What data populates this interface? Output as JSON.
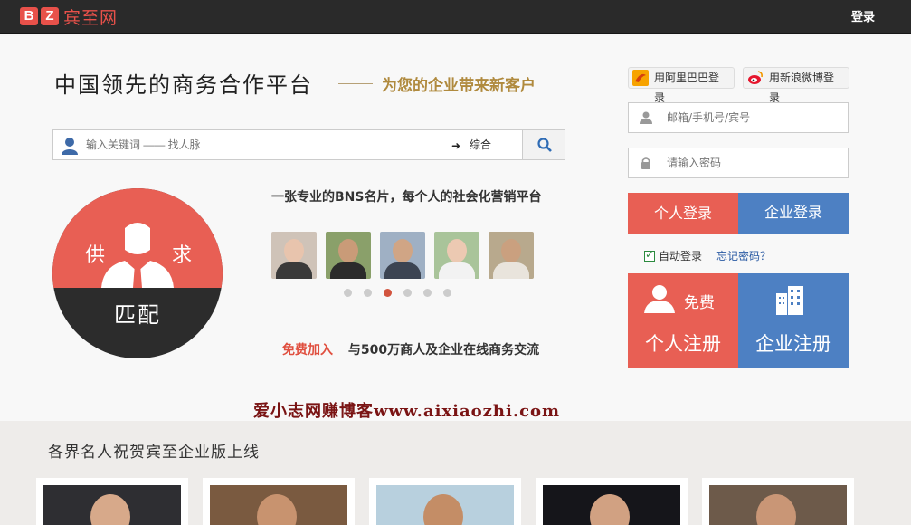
{
  "topbar": {
    "logo_letters": [
      "B",
      "Z"
    ],
    "logo_text": "宾至网",
    "login": "登录"
  },
  "hero": {
    "slogan": "中国领先的商务合作平台",
    "slogan_sub": "为您的企业带来新客户",
    "search": {
      "placeholder": "输入关键词 —— 找人脉",
      "category": "综合"
    },
    "circle": {
      "left": "供",
      "right": "求",
      "bottom": "匹配"
    },
    "card_line": "一张专业的BNS名片，每个人的社会化营销平台",
    "carousel": {
      "active_index": 2,
      "count": 6
    },
    "join_free": "免费加入",
    "join_text": "与500万商人及企业在线商务交流"
  },
  "login": {
    "ali_login": "用阿里巴巴登录",
    "weibo_login": "用新浪微博登录",
    "username_placeholder": "邮箱/手机号/宾号",
    "password_placeholder": "请输入密码",
    "personal_login": "个人登录",
    "company_login": "企业登录",
    "auto_login": "自动登录",
    "auto_login_checked": true,
    "forgot": "忘记密码？",
    "free_badge": "免费",
    "personal_register": "个人注册",
    "company_register": "企业注册"
  },
  "watermark": "爱小志网赚博客www.aixiaozhi.com",
  "bottom": {
    "title": "各界名人祝贺宾至企业版上线"
  },
  "colors": {
    "red": "#e85f54",
    "blue": "#4d80c3",
    "gold": "#b08a3e",
    "topbar": "#2a2a2a"
  }
}
